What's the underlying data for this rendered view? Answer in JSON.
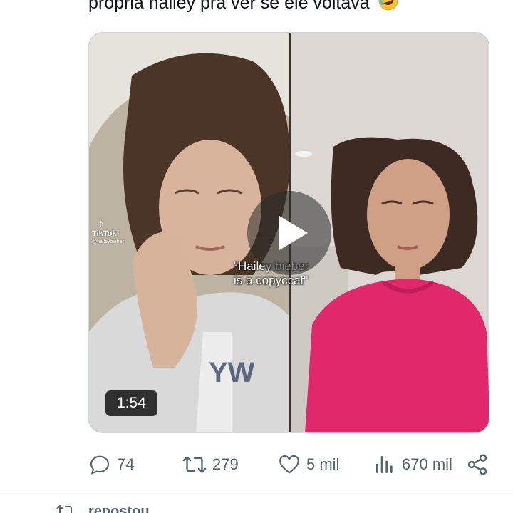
{
  "tweet": {
    "text": "propria hailey pra ver se ele voltava",
    "emoji": "rolling-on-floor-laughing"
  },
  "media": {
    "tiktok_logo_text": "TikTok",
    "tiktok_handle": "@haileybieber",
    "caption": "\"Hailey bieber\nis a copyccat\"",
    "duration": "1:54"
  },
  "actions": {
    "replies": "74",
    "reposts": "279",
    "likes": "5 mil",
    "views": "670 mil"
  },
  "next_tweet": {
    "social_context": "repostou"
  },
  "colors": {
    "text": "#0f1419",
    "muted": "#536471",
    "border": "#cfd9de"
  }
}
